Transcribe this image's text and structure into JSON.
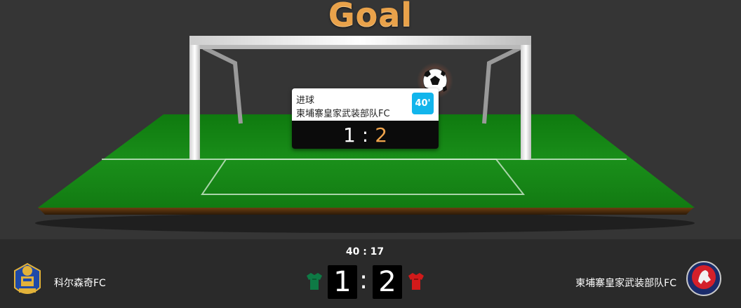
{
  "headline": "Goal",
  "event": {
    "type": "进球",
    "team": "柬埔寨皇家武装部队FC",
    "minute": "40'",
    "score_home": "1",
    "score_separator": ":",
    "score_away": "2"
  },
  "match": {
    "clock": "40 : 17",
    "home_team": "科尔森奇FC",
    "away_team": "柬埔寨皇家武装部队FC",
    "home_score": "1",
    "separator": ":",
    "away_score": "2"
  },
  "colors": {
    "accent_gold": "#e9a24a",
    "minute_badge": "#12b5ec",
    "home_kit": "#0e7a45",
    "away_kit": "#d11a1a",
    "pitch": "#1e8a1e"
  },
  "icons": {
    "ball": "soccer-ball-icon",
    "home_kit": "jersey-icon",
    "away_kit": "jersey-icon",
    "home_logo": "club-crest-icon",
    "away_logo": "club-crest-icon"
  }
}
